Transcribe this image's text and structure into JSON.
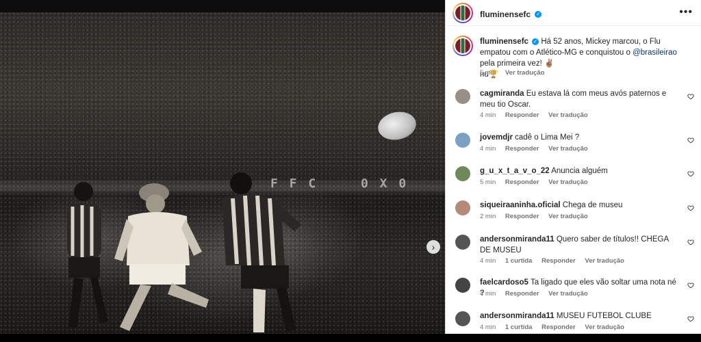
{
  "post": {
    "author": "fluminensefc",
    "caption_user": "fluminensefc",
    "caption_text": "Há 52 anos, Mickey marcou, o Flu empatou com o Atlético-MG e conquistou o",
    "caption_mention": "@brasileirao",
    "caption_rest": "pela primeira vez! ✌🏽",
    "caption_line3": "нu🏆",
    "time": "5 min",
    "see_translation": "Ver tradução"
  },
  "photo": {
    "scoreboard_left": "F F C",
    "scoreboard_right": "0 X 0",
    "next_icon": "chevron-right-icon"
  },
  "labels": {
    "reply": "Responder",
    "see_translation": "Ver tradução"
  },
  "comments": [
    {
      "user": "cagmiranda",
      "text": "Eu estava lá com meus avós paternos e meu tio Oscar.",
      "time": "4 min",
      "likes": ""
    },
    {
      "user": "jovemdjr",
      "text": "cadê o Lima Mei ?",
      "time": "4 min",
      "likes": ""
    },
    {
      "user": "g_u_x_t_a_v_o_22",
      "text": "Anuncia alguém",
      "time": "5 min",
      "likes": ""
    },
    {
      "user": "siqueiraaninha.oficial",
      "text": "Chega de museu",
      "time": "2 min",
      "likes": ""
    },
    {
      "user": "andersonmiranda11",
      "text": "Quero saber de títulos!! CHEGA DE MUSEU",
      "time": "4 min",
      "likes": "1 curtida"
    },
    {
      "user": "faelcardoso5",
      "text": "Ta ligado que eles vão soltar uma nota né ?",
      "time": "4 min",
      "likes": ""
    },
    {
      "user": "andersonmiranda11",
      "text": "MUSEU FUTEBOL CLUBE",
      "time": "4 min",
      "likes": "1 curtida"
    }
  ],
  "colors": {
    "verified": "#0095f6",
    "meta": "#737373",
    "text": "#262626",
    "mention": "#00376b"
  }
}
